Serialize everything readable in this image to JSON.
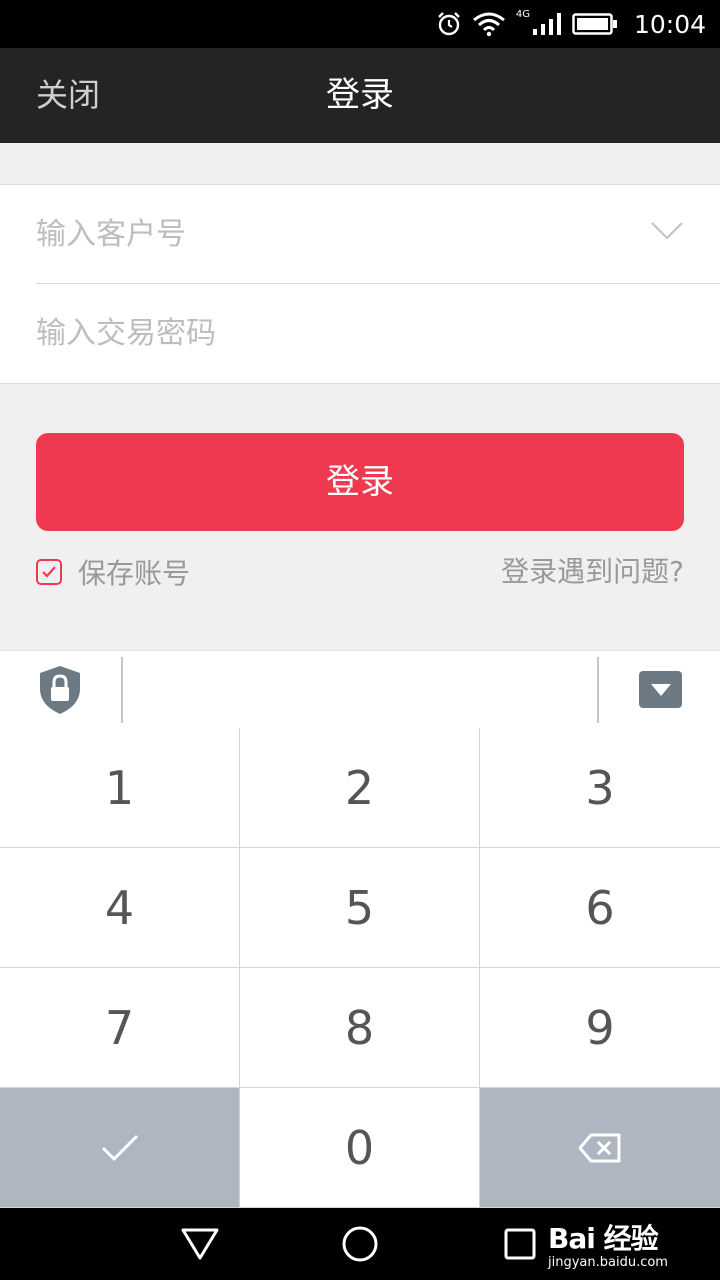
{
  "status_bar": {
    "time": "10:04",
    "network": "4G",
    "icons": [
      "alarm-icon",
      "wifi-icon",
      "signal-icon",
      "battery-icon"
    ]
  },
  "title_bar": {
    "close_label": "关闭",
    "title": "登录"
  },
  "form": {
    "account": {
      "placeholder": "输入客户号",
      "value": ""
    },
    "password": {
      "placeholder": "输入交易密码",
      "value": ""
    }
  },
  "login_button": {
    "label": "登录"
  },
  "save_account": {
    "label": "保存账号",
    "checked": true
  },
  "help_link": {
    "label": "登录遇到问题?"
  },
  "keyboard": {
    "keys": [
      "1",
      "2",
      "3",
      "4",
      "5",
      "6",
      "7",
      "8",
      "9",
      "✓",
      "0",
      "⌫"
    ]
  },
  "watermark": {
    "brand": "Bai 经验",
    "sub": "jingyan.baidu.com"
  },
  "colors": {
    "accent": "#ef3950",
    "title_bar": "#242424",
    "function_key": "#aeb6c1"
  }
}
